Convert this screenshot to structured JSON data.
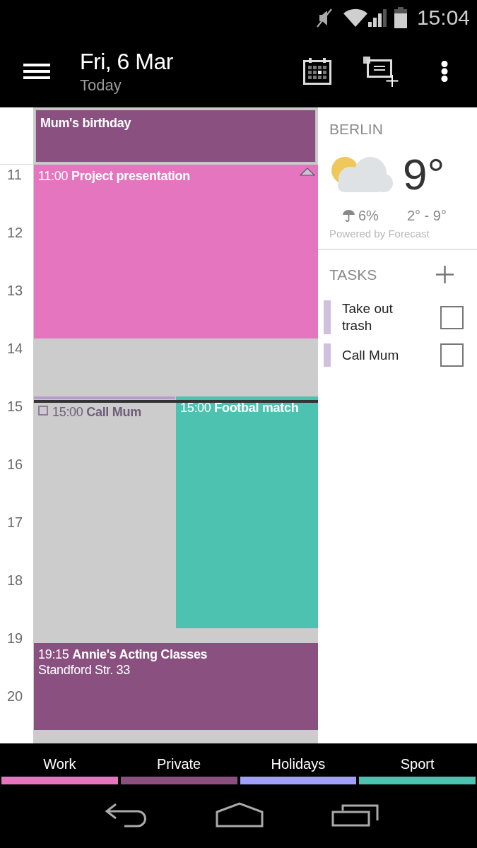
{
  "status_bar": {
    "time": "15:04"
  },
  "app_bar": {
    "title": "Fri, 6 Mar",
    "subtitle": "Today"
  },
  "all_day_events": [
    {
      "title": "Mum's birthday",
      "color": "#8a5180"
    }
  ],
  "hours": [
    "11",
    "12",
    "13",
    "14",
    "15",
    "16",
    "17",
    "18",
    "19",
    "20"
  ],
  "timed_items": [
    {
      "kind": "event",
      "start": "11:00",
      "title": "Project presentation",
      "color": "#e475be",
      "collapsible": true
    },
    {
      "kind": "task",
      "start": "15:00",
      "title": "Call Mum",
      "color": "#b89dcc",
      "checked": false
    },
    {
      "kind": "event",
      "start": "15:00",
      "title": "Footbal match",
      "color": "#4dc2b0",
      "collapsible": false
    },
    {
      "kind": "event",
      "start": "19:15",
      "title": "Annie's Acting Classes",
      "location": "Standford Str. 33",
      "color": "#8a5180",
      "collapsible": false
    }
  ],
  "weather": {
    "city": "BERLIN",
    "temperature": "9°",
    "precipitation": "6%",
    "range": "2° - 9°",
    "credit": "Powered by Forecast"
  },
  "tasks_panel": {
    "heading": "TASKS",
    "tasks": [
      {
        "title": "Take out trash",
        "checked": false
      },
      {
        "title": "Call Mum",
        "checked": false
      }
    ]
  },
  "categories": [
    {
      "label": "Work",
      "color": "#e475be"
    },
    {
      "label": "Private",
      "color": "#8a5180"
    },
    {
      "label": "Holidays",
      "color": "#a0a0f8"
    },
    {
      "label": "Sport",
      "color": "#4dc2b0"
    }
  ]
}
